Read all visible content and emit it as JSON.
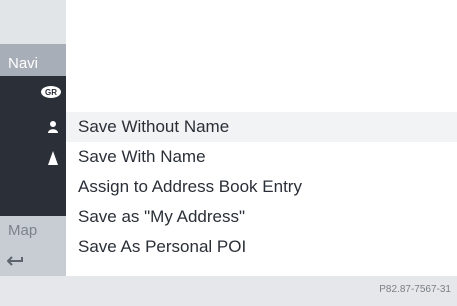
{
  "sidebar": {
    "navi_label": "Navi",
    "map_label": "Map",
    "icons": [
      "gr-badge-icon",
      "person-icon",
      "marker-icon",
      "back-arrow-icon"
    ]
  },
  "menu": {
    "items": [
      {
        "label": "Save Without Name",
        "selected": true
      },
      {
        "label": "Save With Name",
        "selected": false
      },
      {
        "label": "Assign to Address Book Entry",
        "selected": false
      },
      {
        "label": "Save as \"My Address\"",
        "selected": false
      },
      {
        "label": "Save As Personal POI",
        "selected": false
      }
    ]
  },
  "footer": {
    "code": "P82.87-7567-31"
  },
  "colors": {
    "sidebar_dark": "#2b3038",
    "sidebar_mid": "#a7aeb8",
    "sidebar_light": "#c8cdd3",
    "text": "#2a2f37",
    "highlight": "#f2f3f4"
  }
}
